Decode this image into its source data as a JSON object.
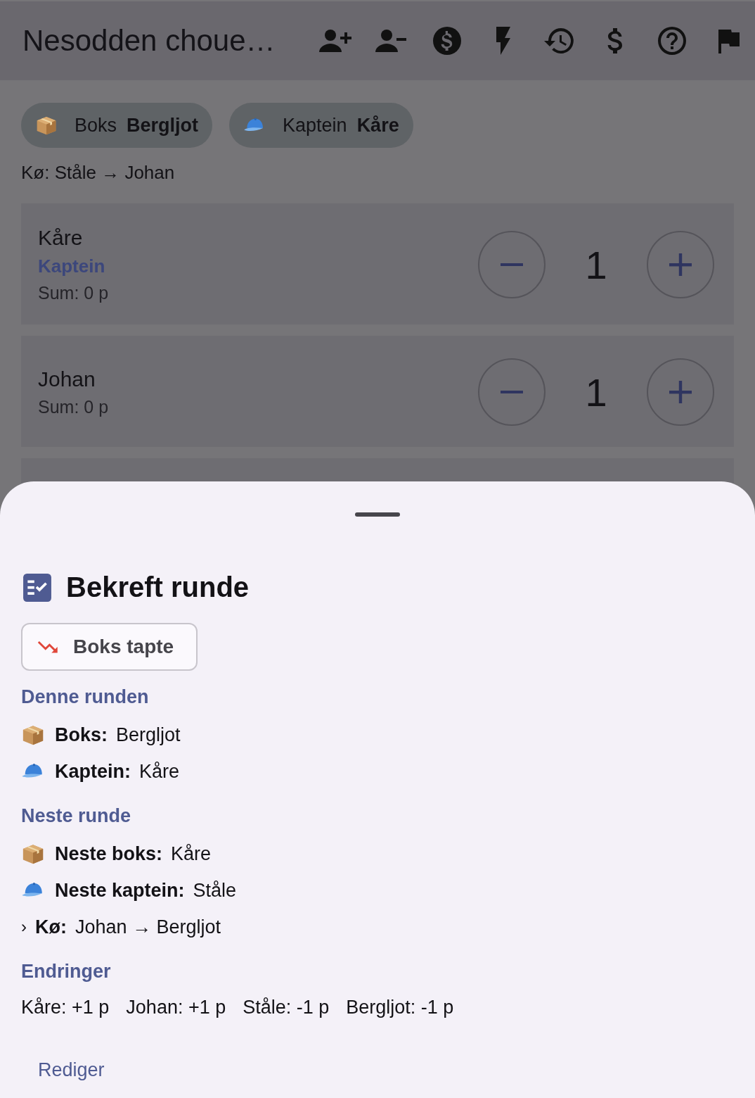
{
  "app_bar": {
    "title": "Nesodden choue…"
  },
  "chips": [
    {
      "kind": "box",
      "label": "Boks",
      "value": "Bergljot"
    },
    {
      "kind": "captain",
      "label": "Kaptein",
      "value": "Kåre"
    }
  ],
  "queue": "Kø: Ståle → Johan",
  "players": [
    {
      "name": "Kåre",
      "role": "Kaptein",
      "sum": "Sum: 0 p",
      "count": "1"
    },
    {
      "name": "Johan",
      "sum": "Sum: 0 p",
      "count": "1"
    }
  ],
  "sheet": {
    "title": "Bekreft runde",
    "action_button": "Boks tapte",
    "sections": [
      {
        "heading": "Denne runden",
        "rows": [
          {
            "kind": "box",
            "label": "Boks:",
            "value": "Bergljot"
          },
          {
            "kind": "captain",
            "label": "Kaptein:",
            "value": "Kåre"
          }
        ]
      },
      {
        "heading": "Neste runde",
        "rows": [
          {
            "kind": "box",
            "label": "Neste boks:",
            "value": "Kåre"
          },
          {
            "kind": "captain",
            "label": "Neste kaptein:",
            "value": "Ståle"
          },
          {
            "kind": "queue",
            "marker": "›",
            "label": "Kø:",
            "value": "Johan → Bergljot"
          }
        ]
      },
      {
        "heading": "Endringer",
        "changes": [
          "Kåre: +1 p",
          "Johan: +1 p",
          "Ståle: -1 p",
          "Bergljot: -1 p"
        ]
      }
    ],
    "edit_button": "Rediger"
  }
}
